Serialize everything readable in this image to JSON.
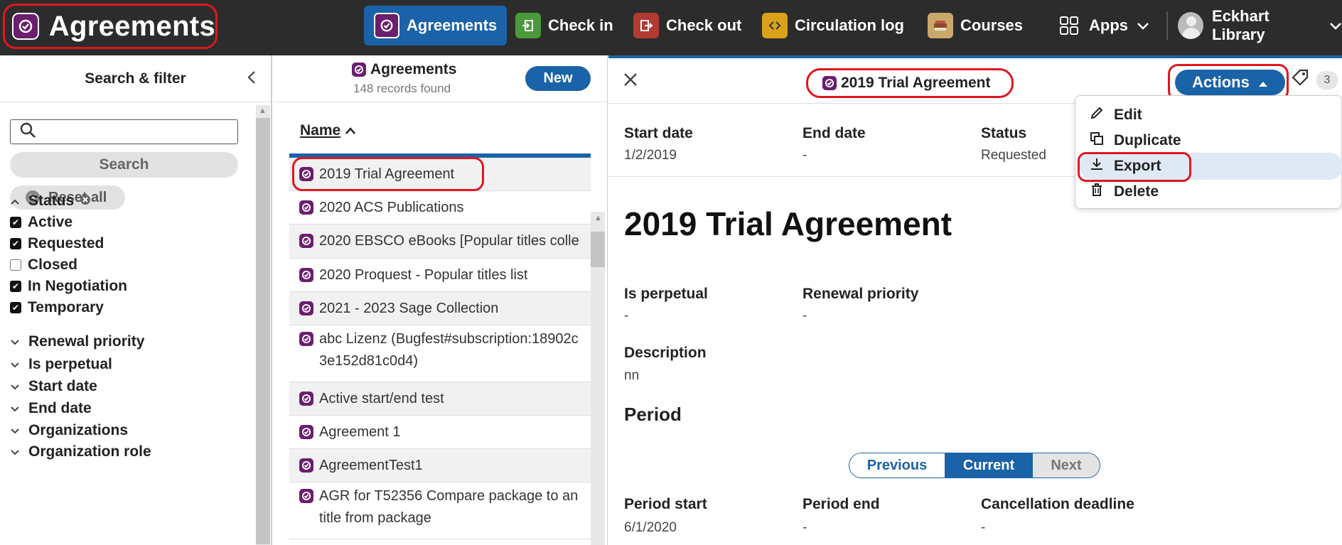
{
  "header": {
    "app_title": "Agreements",
    "nav": [
      {
        "label": "Agreements",
        "icon": "agreements-icon",
        "color": "#6b1e6e"
      },
      {
        "label": "Check in",
        "icon": "check-in-icon",
        "color": "#4a9a3c"
      },
      {
        "label": "Check out",
        "icon": "check-out-icon",
        "color": "#b23a33"
      },
      {
        "label": "Circulation log",
        "icon": "circulation-log-icon",
        "color": "#d9a21a"
      },
      {
        "label": "Courses",
        "icon": "courses-icon",
        "color": "#c9a86a"
      },
      {
        "label": "Apps",
        "icon": "apps-grid-icon"
      }
    ],
    "user": "Eckhart Library"
  },
  "filters": {
    "title": "Search & filter",
    "search_button": "Search",
    "reset_button": "Reset all",
    "status_heading": "Status",
    "status_options": [
      {
        "label": "Active",
        "checked": true
      },
      {
        "label": "Requested",
        "checked": true
      },
      {
        "label": "Closed",
        "checked": false
      },
      {
        "label": "In Negotiation",
        "checked": true
      },
      {
        "label": "Temporary",
        "checked": true
      }
    ],
    "collapsed_groups": [
      "Renewal priority",
      "Is perpetual",
      "Start date",
      "End date",
      "Organizations",
      "Organization role"
    ]
  },
  "results": {
    "title": "Agreements",
    "count": "148 records found",
    "new_button": "New",
    "column": "Name",
    "rows": [
      "2019 Trial Agreement",
      "2020 ACS Publications",
      "2020 EBSCO eBooks [Popular titles colle",
      "2020 Proquest - Popular titles list",
      "2021 - 2023 Sage Collection",
      "abc Lizenz (Bugfest#subscription:18902c 3e152d81c0d4)",
      "Active start/end test",
      "Agreement 1",
      "AgreementTest1",
      "AGR for T52356 Compare package to an title from package"
    ]
  },
  "record": {
    "title": "2019 Trial Agreement",
    "actions_label": "Actions",
    "tag_count": "3",
    "start_date_label": "Start date",
    "start_date": "1/2/2019",
    "end_date_label": "End date",
    "end_date": "-",
    "status_label": "Status",
    "status": "Requested",
    "heading": "2019 Trial Agreement",
    "is_perpetual_label": "Is perpetual",
    "is_perpetual": "-",
    "renewal_priority_label": "Renewal priority",
    "renewal_priority": "-",
    "description_label": "Description",
    "description": "nn",
    "period_heading": "Period",
    "period_tabs": {
      "previous": "Previous",
      "current": "Current",
      "next": "Next"
    },
    "period_start_label": "Period start",
    "period_start": "6/1/2020",
    "period_end_label": "Period end",
    "period_end": "-",
    "cancellation_label": "Cancellation deadline",
    "cancellation": "-"
  },
  "actions_menu": {
    "items": [
      {
        "label": "Edit",
        "icon": "pencil-icon"
      },
      {
        "label": "Duplicate",
        "icon": "duplicate-icon"
      },
      {
        "label": "Export",
        "icon": "download-icon"
      },
      {
        "label": "Delete",
        "icon": "trash-icon"
      }
    ]
  },
  "colors": {
    "accent": "#1b63a8",
    "highlight": "#e0161d",
    "agreements": "#6b1e6e"
  }
}
